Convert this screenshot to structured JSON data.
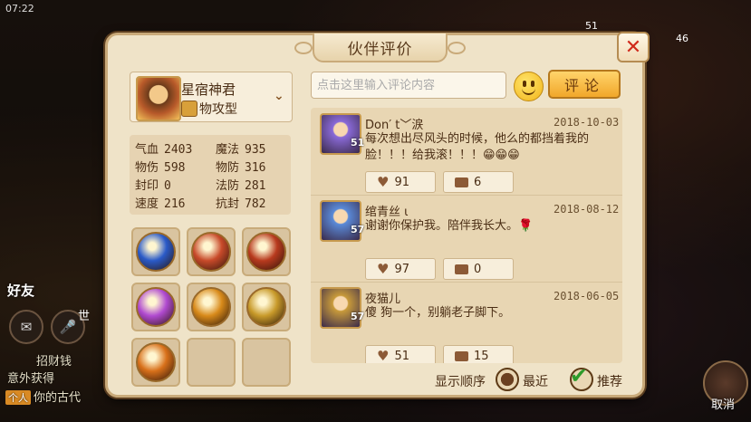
{
  "status_bar": {
    "time": "07:22"
  },
  "background": {
    "top_numbers": [
      "51",
      "46"
    ],
    "friends_label": "好友",
    "world_label": "世",
    "chat": [
      {
        "tag": "",
        "text": "招财钱"
      },
      {
        "tag": "",
        "text": "意外获得"
      },
      {
        "tag": "个人",
        "text": "你的古代"
      }
    ],
    "cancel_label": "取消"
  },
  "dialog": {
    "title": "伙伴评价",
    "close_symbol": "✕",
    "partner": {
      "name": "星宿神君",
      "type": "物攻型"
    },
    "stats": [
      [
        {
          "label": "气血",
          "value": "2403"
        },
        {
          "label": "魔法",
          "value": "935"
        }
      ],
      [
        {
          "label": "物伤",
          "value": "598"
        },
        {
          "label": "物防",
          "value": "316"
        }
      ],
      [
        {
          "label": "封印",
          "value": "0"
        },
        {
          "label": "法防",
          "value": "281"
        }
      ],
      [
        {
          "label": "速度",
          "value": "216"
        },
        {
          "label": "抗封",
          "value": "782"
        }
      ]
    ],
    "skills": [
      {
        "icon": "blue-slash-skill-icon",
        "color": "#2a5ac8"
      },
      {
        "icon": "fire-swirl-skill-icon",
        "color": "#c84a2a"
      },
      {
        "icon": "red-beast-skill-icon",
        "color": "#b83a1e"
      },
      {
        "icon": "purple-vortex-skill-icon",
        "color": "#b04ad0"
      },
      {
        "icon": "golden-flame-skill-icon",
        "color": "#d88a1a"
      },
      {
        "icon": "golden-guard-skill-icon",
        "color": "#c89a2a"
      },
      {
        "icon": "orange-flame-skill-icon",
        "color": "#d8701a"
      },
      {
        "icon": "",
        "color": ""
      },
      {
        "icon": "",
        "color": ""
      }
    ],
    "comment_input": {
      "placeholder": "点击这里输入评论内容",
      "value": ""
    },
    "comment_button": "评论",
    "comments": [
      {
        "name": "Don′ t﹀涙",
        "level": "51",
        "date": "2018-10-03",
        "text": "每次想出尽风头的时候，他么的都挡着我的脸！！！给我滚！！！😁😁😁",
        "likes": "91",
        "replies": "6",
        "avatar_color": "#8a6ad8"
      },
      {
        "name": "绾青丝 ι",
        "level": "57",
        "date": "2018-08-12",
        "text": "谢谢你保护我。陪伴我长大。🌹",
        "likes": "97",
        "replies": "0",
        "avatar_color": "#5a8ad8"
      },
      {
        "name": "夜猫儿",
        "level": "57",
        "date": "2018-06-05",
        "text": "傻 狗一个，别躺老子脚下。",
        "likes": "51",
        "replies": "15",
        "avatar_color": "#c89a3a"
      }
    ],
    "sort": {
      "label": "显示顺序",
      "options": [
        "最近",
        "推荐"
      ],
      "selected": "推荐"
    }
  },
  "colors": {
    "dialog_bg": "#efe3c8",
    "accent_button": "#f1a72a",
    "close_red": "#d02a1a",
    "check_green": "#2d9a2a"
  }
}
